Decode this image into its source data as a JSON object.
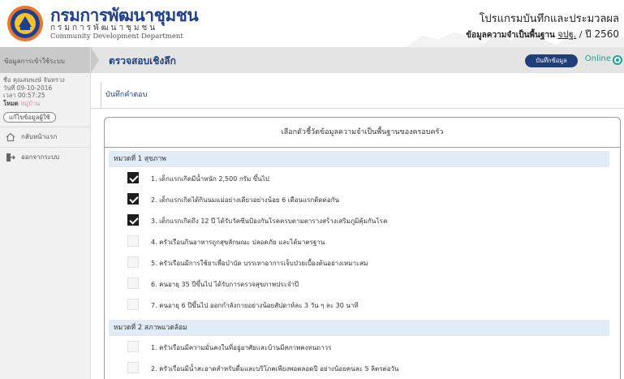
{
  "header": {
    "org_name_th": "กรมการพัฒนาชุมชน",
    "org_name_th_spaced": "กรมการพัฒนาชุมชน",
    "org_name_en": "Community Development Department",
    "program_title": "โปรแกรมบันทึกและประมวลผล",
    "program_sub_bold": "ข้อมูลความจำเป็นพื้นฐาน",
    "program_sub_short": "จปฐ.",
    "program_sub_sep": "/",
    "program_sub_year": "ปี 2560",
    "logo_icon": "cdd-seal-logo"
  },
  "sidebar": {
    "header": "ข้อมูลการเข้าใช้ระบบ",
    "user_name": "ชื่อ คุณสมพงษ์ จันทรวง",
    "date": "วันที่ 09-10-2016",
    "time": "เวลา 00:57:25",
    "role_label": "โหมด",
    "role_value": "หมู่บ้าน",
    "edit_button": "แก้ไขข้อมูลผู้ใช้",
    "items": [
      {
        "label": "กลับหน้าแรก",
        "icon": "home-icon"
      },
      {
        "label": "ออกจากระบบ",
        "icon": "logout-icon"
      }
    ]
  },
  "topbar": {
    "title": "ตรวจสอบเชิงลึก",
    "save_button": "บันทึกข้อมูล",
    "status": "Online",
    "status_color": "#17a589",
    "accent": "#1f3f7a"
  },
  "breadcrumb": {
    "label": "บันทึกคำตอบ"
  },
  "panel": {
    "title": "เลือกตัวชี้วัดข้อมูลความจำเป็นพื้นฐานของครอบครัว",
    "categories": [
      {
        "title": "หมวดที่ 1 สุขภาพ",
        "items": [
          {
            "label": "1. เด็กแรกเกิดมีน้ำหนัก 2,500 กรัม ขึ้นไป",
            "checked": true
          },
          {
            "label": "2. เด็กแรกเกิดได้กินนมแม่อย่างเดียวอย่างน้อย 6 เดือนแรกติดต่อกัน",
            "checked": true
          },
          {
            "label": "3. เด็กแรกเกิดถึง 12 ปี ได้รับวัคซีนป้องกันโรคครบตามตารางสร้างเสริมภูมิคุ้มกันโรค",
            "checked": true
          },
          {
            "label": "4. ครัวเรือนกินอาหารถูกสุขลักษณะ ปลอดภัย และได้มาตรฐาน",
            "checked": false
          },
          {
            "label": "5. ครัวเรือนมีการใช้ยาเพื่อบำบัด บรรเทาอาการเจ็บป่วยเบื้องต้นอย่างเหมาะสม",
            "checked": false
          },
          {
            "label": "6. คนอายุ 35 ปีขึ้นไป ได้รับการตรวจสุขภาพประจำปี",
            "checked": false
          },
          {
            "label": "7. คนอายุ 6 ปีขึ้นไป ออกกำลังกายอย่างน้อยสัปดาห์ละ 3 วัน ๆ ละ 30 นาที",
            "checked": false
          }
        ]
      },
      {
        "title": "หมวดที่ 2 สภาพแวดล้อม",
        "items": [
          {
            "label": "1. ครัวเรือนมีความมั่นคงในที่อยู่อาศัยและบ้านมีสภาพคงทนถาวร",
            "checked": false
          },
          {
            "label": "2. ครัวเรือนมีน้ำสะอาดสำหรับดื่มและบริโภคเพียงพอตลอดปี อย่างน้อยคนละ 5 ลิตรต่อวัน",
            "checked": false
          }
        ]
      }
    ]
  }
}
